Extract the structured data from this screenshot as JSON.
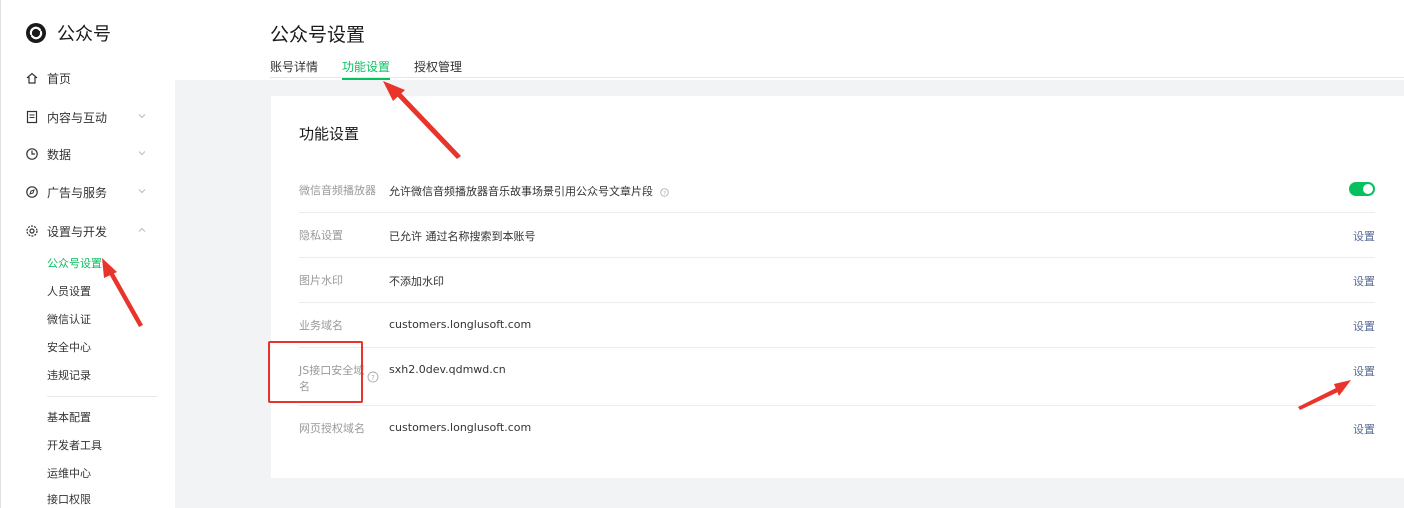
{
  "brand": {
    "name": "公众号",
    "logo_icon": "wechat-logo-icon"
  },
  "sidebar": {
    "items": [
      {
        "label": "首页",
        "icon": "home-icon"
      },
      {
        "label": "内容与互动",
        "icon": "document-icon"
      },
      {
        "label": "数据",
        "icon": "chart-clock-icon"
      },
      {
        "label": "广告与服务",
        "icon": "compass-icon"
      },
      {
        "label": "设置与开发",
        "icon": "gear-icon"
      }
    ],
    "sub_items_settings": [
      "公众号设置",
      "人员设置",
      "微信认证",
      "安全中心",
      "违规记录"
    ],
    "sub_items_dev": [
      "基本配置",
      "开发者工具",
      "运维中心",
      "接口权限"
    ]
  },
  "header": {
    "title": "公众号设置",
    "tabs": [
      "账号详情",
      "功能设置",
      "授权管理"
    ]
  },
  "card": {
    "title": "功能设置",
    "rows": [
      {
        "label": "微信音频播放器",
        "value": "允许微信音频播放器音乐故事场景引用公众号文章片段",
        "action": ""
      },
      {
        "label": "隐私设置",
        "value": "已允许 通过名称搜索到本账号",
        "action": "设置"
      },
      {
        "label": "图片水印",
        "value": "不添加水印",
        "action": "设置"
      },
      {
        "label": "业务域名",
        "value": "customers.longlusoft.com",
        "action": "设置"
      },
      {
        "label": "JS接口安全域名",
        "value": "sxh2.0dev.qdmwd.cn",
        "action": "设置"
      },
      {
        "label": "网页授权域名",
        "value": "customers.longlusoft.com",
        "action": "设置"
      }
    ]
  },
  "colors": {
    "accent": "#07c160",
    "link": "#576b95",
    "annotation": "#e8342b"
  }
}
